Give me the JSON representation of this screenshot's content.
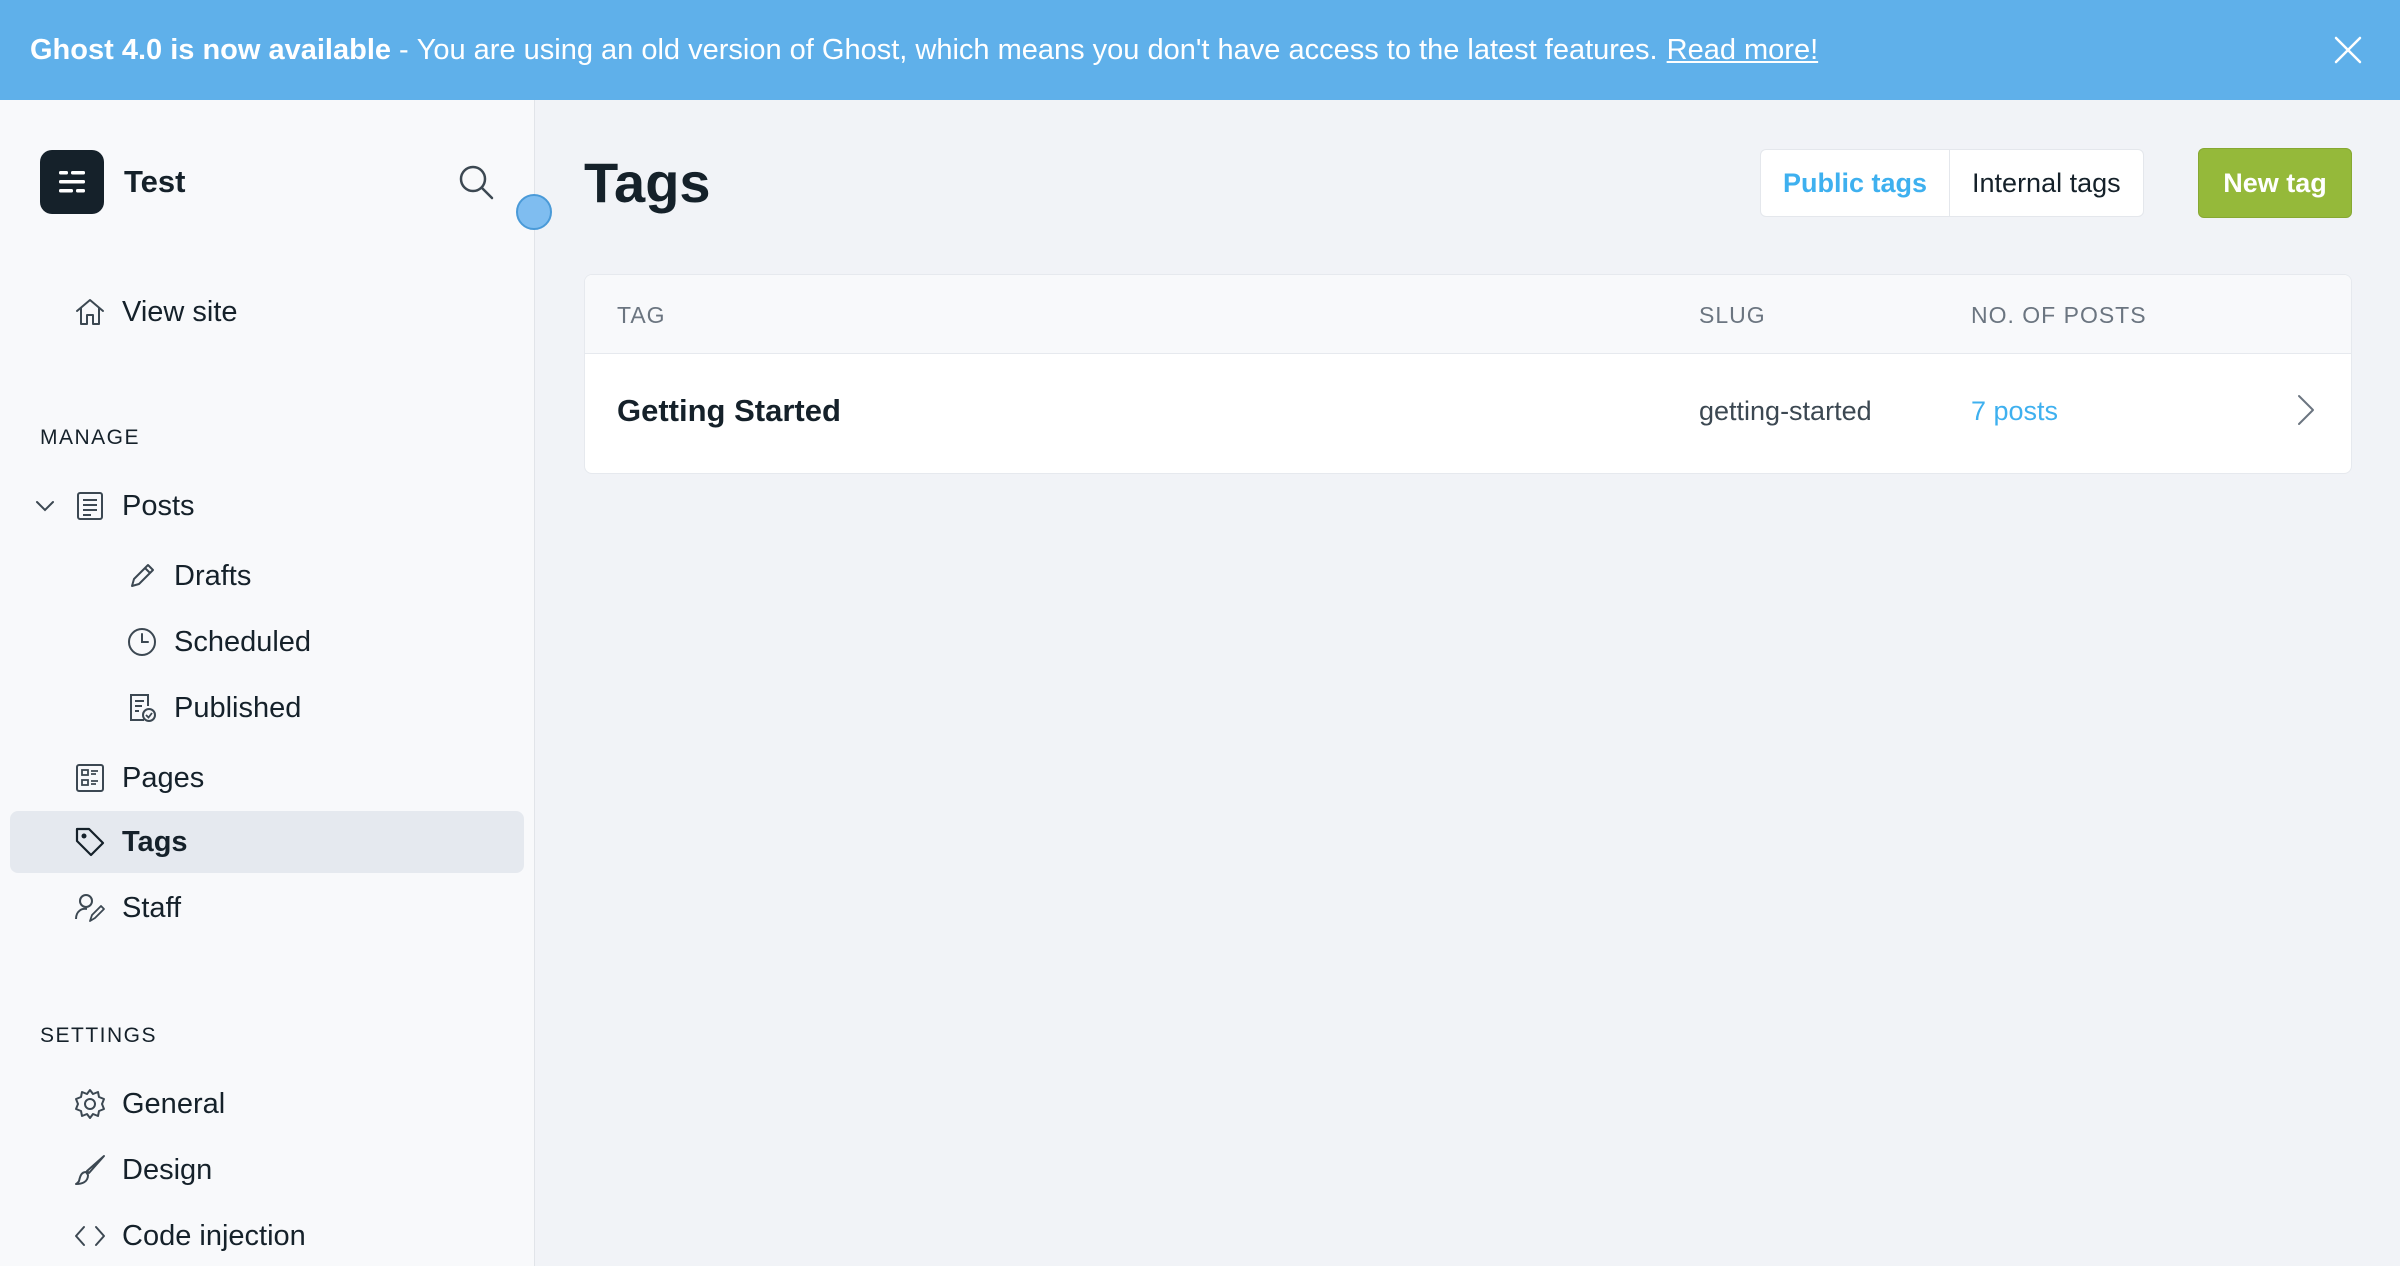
{
  "banner": {
    "title": "Ghost 4.0 is now available",
    "separator": "-",
    "message": "You are using an old version of Ghost, which means you don't have access to the latest features.",
    "link": "Read more!",
    "close_icon": "close-icon"
  },
  "sidebar": {
    "site_name": "Test",
    "view_site": "View site",
    "manage_label": "MANAGE",
    "settings_label": "SETTINGS",
    "items": {
      "posts": "Posts",
      "drafts": "Drafts",
      "scheduled": "Scheduled",
      "published": "Published",
      "pages": "Pages",
      "tags": "Tags",
      "staff": "Staff",
      "general": "General",
      "design": "Design",
      "code_injection": "Code injection"
    }
  },
  "main": {
    "title": "Tags",
    "tabs": {
      "public": "Public tags",
      "internal": "Internal tags",
      "active": "public"
    },
    "new_tag": "New tag",
    "table": {
      "headers": {
        "tag": "TAG",
        "slug": "SLUG",
        "posts": "NO. OF POSTS"
      },
      "rows": [
        {
          "name": "Getting Started",
          "slug": "getting-started",
          "count": "7 posts"
        }
      ]
    }
  },
  "colors": {
    "banner": "#5fb0ea",
    "accent": "#3eb0ef",
    "primary_button": "#95b93a",
    "active_nav": "#e5e9ef"
  }
}
